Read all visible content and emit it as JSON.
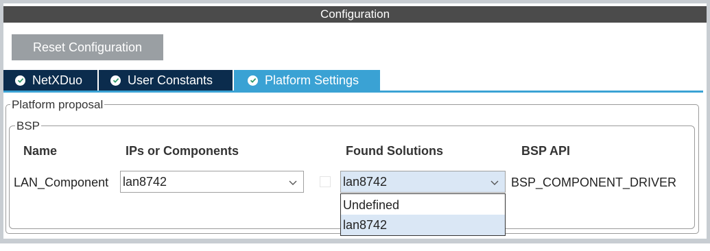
{
  "window": {
    "title": "Configuration"
  },
  "toolbar": {
    "reset_label": "Reset Configuration"
  },
  "tabs": [
    {
      "label": "NetXDuo",
      "active": false
    },
    {
      "label": "User Constants",
      "active": false
    },
    {
      "label": "Platform Settings",
      "active": true
    }
  ],
  "platform_proposal": {
    "legend": "Platform proposal",
    "bsp": {
      "legend": "BSP",
      "headers": {
        "name": "Name",
        "ips": "IPs or Components",
        "found": "Found Solutions",
        "api": "BSP API"
      },
      "rows": [
        {
          "name": "LAN_Component",
          "ip_value": "lan8742",
          "found_value": "lan8742",
          "api": "BSP_COMPONENT_DRIVER"
        }
      ],
      "found_dropdown": {
        "options": [
          "Undefined",
          "lan8742"
        ],
        "selected": "lan8742"
      }
    }
  },
  "colors": {
    "title_bar": "#4b4b4b",
    "tab_inactive": "#0b2c4d",
    "tab_active": "#3aa2d4",
    "reset_button": "#9a9fa3",
    "selection": "#dae7f5"
  }
}
